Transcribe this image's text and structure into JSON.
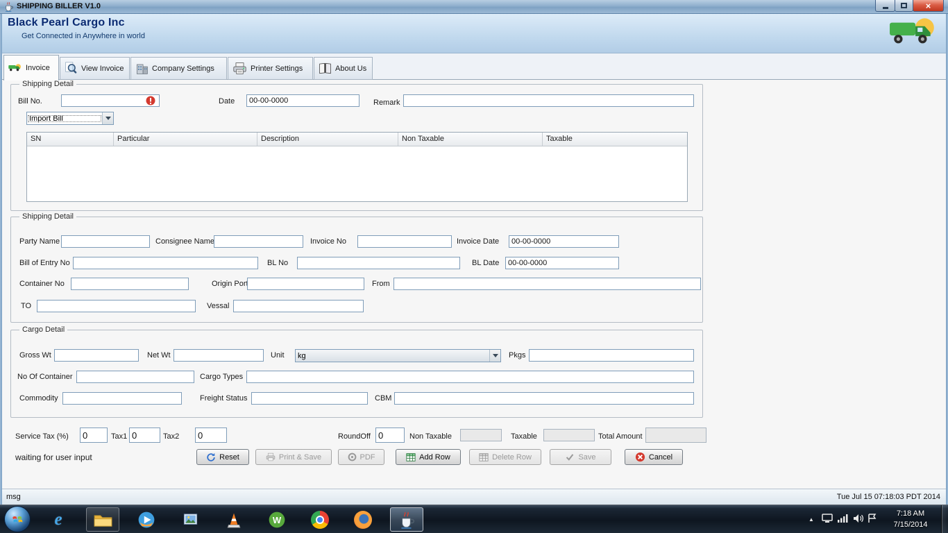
{
  "window": {
    "title": "SHIPPING BILLER V1.0"
  },
  "header": {
    "company_name": "Black Pearl Cargo Inc",
    "tagline": "Get Connected in Anywhere in world"
  },
  "tabs": {
    "invoice": "Invoice",
    "view_invoice": "View Invoice",
    "company_settings": "Company Settings",
    "printer_settings": "Printer Settings",
    "about_us": "About Us"
  },
  "shipping_top": {
    "title": "Shipping Detail",
    "bill_no_label": "Bill No.",
    "date_label": "Date",
    "date_value": "00-00-0000",
    "remark_label": "Remark",
    "bill_type_selected": "Import Bill",
    "table_columns": [
      "SN",
      "Particular",
      "Description",
      "Non Taxable",
      "Taxable"
    ]
  },
  "shipping_detail": {
    "title": "Shipping Detail",
    "party_name_label": "Party Name",
    "consignee_name_label": "Consignee Name",
    "invoice_no_label": "Invoice No",
    "invoice_date_label": "Invoice Date",
    "invoice_date_value": "00-00-0000",
    "bill_of_entry_no_label": "Bill of Entry No",
    "bl_no_label": "BL No",
    "bl_date_label": "BL Date",
    "bl_date_value": "00-00-0000",
    "container_no_label": "Container No",
    "origin_port_label": "Origin Port",
    "from_label": "From",
    "to_label": "TO",
    "vessal_label": "Vessal"
  },
  "cargo_detail": {
    "title": "Cargo Detail",
    "gross_wt_label": "Gross Wt",
    "net_wt_label": "Net Wt",
    "unit_label": "Unit",
    "unit_selected": "kg",
    "pkgs_label": "Pkgs",
    "no_of_container_label": "No Of Container",
    "cargo_types_label": "Cargo Types",
    "commodity_label": "Commodity",
    "freight_status_label": "Freight Status",
    "cbm_label": "CBM"
  },
  "totals": {
    "service_tax_label": "Service Tax (%)",
    "service_tax_value": "0",
    "tax1_label": "Tax1",
    "tax1_value": "0",
    "tax2_label": "Tax2",
    "tax2_value": "0",
    "roundoff_label": "RoundOff",
    "roundoff_value": "0",
    "non_taxable_label": "Non Taxable",
    "taxable_label": "Taxable",
    "total_amount_label": "Total Amount"
  },
  "status_message": "waiting for user input",
  "action_buttons": {
    "reset": "Reset",
    "print_save": "Print & Save",
    "pdf": "PDF",
    "add_row": "Add Row",
    "delete_row": "Delete Row",
    "save": "Save",
    "cancel": "Cancel"
  },
  "status_bar": {
    "left": "msg",
    "right": "Tue Jul 15 07:18:03 PDT 2014"
  },
  "taskbar": {
    "clock_time": "7:18 AM",
    "clock_date": "7/15/2014",
    "w_app_letter": "W"
  },
  "icons": {
    "window_icon": "java-coffee-cup",
    "brand_logo": "green-delivery-truck",
    "tab_invoice": "truck-icon",
    "tab_view_invoice": "magnifier-over-document",
    "tab_company_settings": "office-building",
    "tab_printer_settings": "printer",
    "tab_about_us": "open-book",
    "bill_no_indicator": "red-exclamation-circle",
    "reset": "blue-refresh-arrows",
    "print_save": "printer-gray",
    "pdf": "gray-ring",
    "add_row": "table-grid-green",
    "delete_row": "table-grid-gray",
    "save": "checkmark-gray",
    "cancel": "red-circle-x"
  },
  "colors": {
    "header_navy": "#0b2b72",
    "brand_green": "#44b04a",
    "alert_red": "#d43a2f",
    "titlebar_blue": "#8fafcd",
    "taskbar_dark": "#0e1620",
    "field_border": "#7f9db9"
  }
}
